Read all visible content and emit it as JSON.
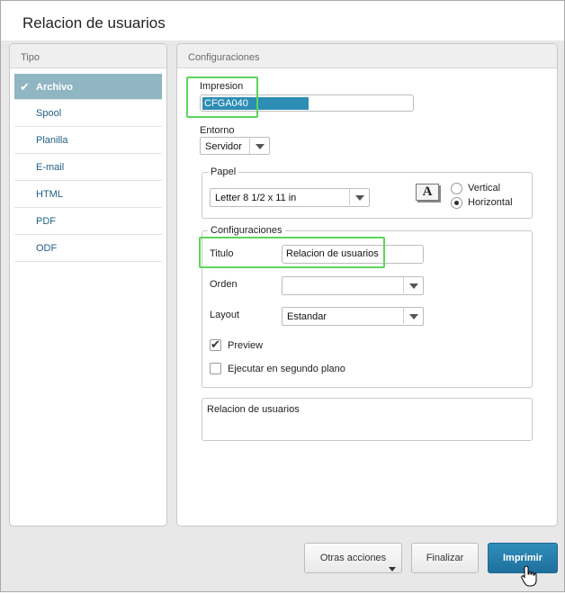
{
  "window": {
    "title": "Relacion de usuarios"
  },
  "tipo": {
    "header": "Tipo",
    "items": [
      {
        "label": "Archivo",
        "active": true
      },
      {
        "label": "Spool"
      },
      {
        "label": "Planilla"
      },
      {
        "label": "E-mail"
      },
      {
        "label": "HTML"
      },
      {
        "label": "PDF"
      },
      {
        "label": "ODF"
      }
    ],
    "check_icon": "✔"
  },
  "config": {
    "header": "Configuraciones",
    "impresion": {
      "label": "Impresion",
      "value": "CFGA040"
    },
    "entorno": {
      "label": "Entorno",
      "value": "Servidor"
    },
    "papel": {
      "legend": "Papel",
      "size": "Letter 8 1/2 x 11 in",
      "orientation_icon": "A",
      "vertical_label": "Vertical",
      "horizontal_label": "Horizontal",
      "selected": "Horizontal"
    },
    "settings": {
      "legend": "Configuraciones",
      "titulo": {
        "label": "Titulo",
        "value": "Relacion de usuarios"
      },
      "orden": {
        "label": "Orden",
        "value": ""
      },
      "layout": {
        "label": "Layout",
        "value": "Estandar"
      },
      "preview": {
        "label": "Preview",
        "checked": true
      },
      "background": {
        "label": "Ejecutar en segundo plano",
        "checked": false
      }
    },
    "description": "Relacion de usuarios"
  },
  "footer": {
    "otras_acciones": "Otras acciones",
    "finalizar": "Finalizar",
    "imprimir": "Imprimir"
  },
  "colors": {
    "accent": "#1f6f9d",
    "active_item": "#8fb6c2",
    "highlight": "#5cd65c",
    "link": "#1e5f84"
  }
}
